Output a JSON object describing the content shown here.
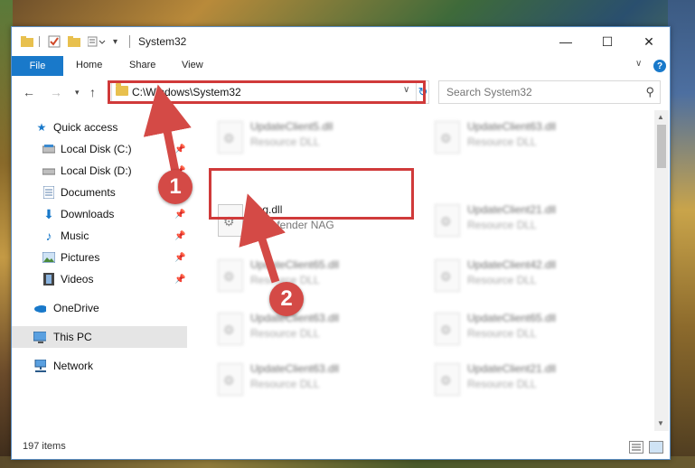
{
  "window": {
    "title": "System32",
    "controls": {
      "minimize": "—",
      "maximize": "☐",
      "close": "✕"
    }
  },
  "ribbon": {
    "tabs": [
      "File",
      "Home",
      "Share",
      "View"
    ],
    "help": "?"
  },
  "address_bar": {
    "path": "C:\\Windows\\System32",
    "search_placeholder": "Search System32"
  },
  "sidebar": {
    "items": [
      {
        "label": "Quick access",
        "icon": "star-icon"
      },
      {
        "label": "Local Disk (C:)",
        "icon": "drive-icon",
        "pinned": true
      },
      {
        "label": "Local Disk (D:)",
        "icon": "drive-icon",
        "pinned": true
      },
      {
        "label": "Documents",
        "icon": "documents-icon",
        "pinned": true
      },
      {
        "label": "Downloads",
        "icon": "download-arrow-icon",
        "pinned": true
      },
      {
        "label": "Music",
        "icon": "music-note-icon",
        "pinned": true
      },
      {
        "label": "Pictures",
        "icon": "pictures-icon",
        "pinned": true
      },
      {
        "label": "Videos",
        "icon": "film-icon",
        "pinned": true
      },
      {
        "label": "OneDrive",
        "icon": "cloud-icon"
      },
      {
        "label": "This PC",
        "icon": "monitor-icon",
        "selected": true
      },
      {
        "label": "Network",
        "icon": "network-icon"
      }
    ]
  },
  "files": {
    "left_column": [
      {
        "name": "UpdateClient5.dll",
        "desc": "Resource DLL",
        "blurred": true
      },
      {
        "name": "nag.dll",
        "desc": "BitDefender NAG",
        "blurred": false
      },
      {
        "name": "UpdateClient65.dll",
        "desc": "Resource DLL",
        "blurred": true
      },
      {
        "name": "UpdateClient63.dll",
        "desc": "Resource DLL",
        "blurred": true
      },
      {
        "name": "UpdateClient63.dll",
        "desc": "Resource DLL",
        "blurred": true
      }
    ],
    "right_column": [
      {
        "name": "UpdateClient63.dll",
        "desc": "Resource DLL",
        "blurred": true
      },
      {
        "name": "UpdateClient21.dll",
        "desc": "Resource DLL",
        "blurred": true
      },
      {
        "name": "UpdateClient42.dll",
        "desc": "Resource DLL",
        "blurred": true
      },
      {
        "name": "UpdateClient65.dll",
        "desc": "Resource DLL",
        "blurred": true
      },
      {
        "name": "UpdateClient21.dll",
        "desc": "Resource DLL",
        "blurred": true
      }
    ]
  },
  "status": {
    "item_count": "197 items"
  },
  "annotations": {
    "step1": "1",
    "step2": "2",
    "color": "#d03a3a"
  }
}
